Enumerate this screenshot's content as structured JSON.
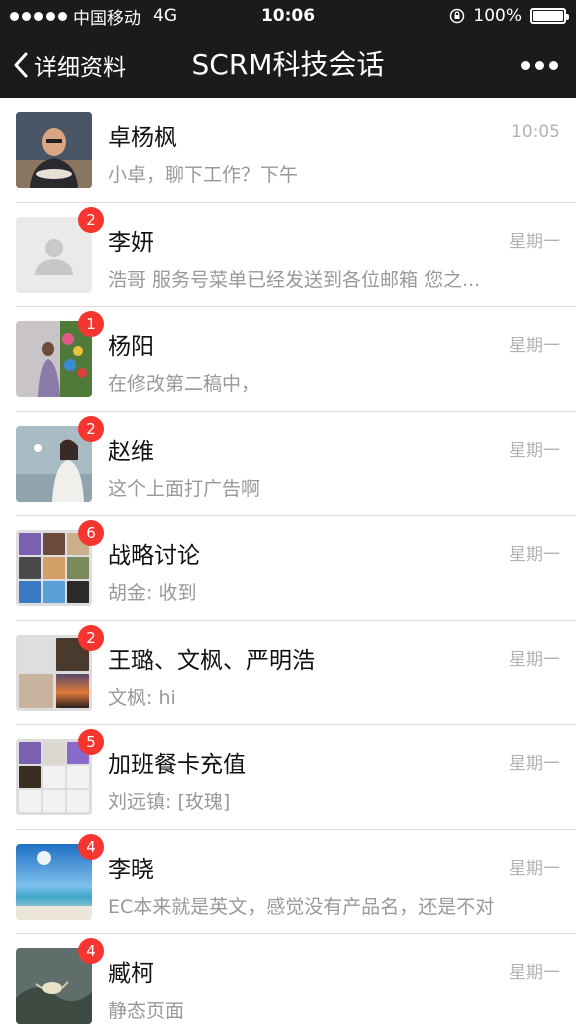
{
  "status_bar": {
    "carrier": "中国移动",
    "network": "4G",
    "time": "10:06",
    "battery": "100%",
    "battery_level": 1.0
  },
  "nav": {
    "back_label": "详细资料",
    "title": "SCRM科技会话"
  },
  "chats": [
    {
      "name": "卓杨枫",
      "time": "10:05",
      "preview": "小卓，聊下工作？下午",
      "badge": ""
    },
    {
      "name": "李妍",
      "time": "星期一",
      "preview": "浩哥  服务号菜单已经发送到各位邮箱    您之...",
      "badge": "2"
    },
    {
      "name": "杨阳",
      "time": "星期一",
      "preview": "在修改第二稿中，",
      "badge": "1"
    },
    {
      "name": "赵维",
      "time": "星期一",
      "preview": "这个上面打广告啊",
      "badge": "2"
    },
    {
      "name": "战略讨论",
      "time": "星期一",
      "preview": "胡金: 收到",
      "badge": "6"
    },
    {
      "name": "王璐、文枫、严明浩",
      "time": "星期一",
      "preview": "文枫: hi",
      "badge": "2"
    },
    {
      "name": "加班餐卡充值",
      "time": "星期一",
      "preview": "刘远镇: [玫瑰]",
      "badge": "5"
    },
    {
      "name": "李晓",
      "time": "星期一",
      "preview": "EC本来就是英文，感觉没有产品名，还是不对",
      "badge": "4"
    },
    {
      "name": "臧柯",
      "time": "星期一",
      "preview": "静态页面",
      "badge": "4"
    }
  ],
  "colors": {
    "bar_bg": "#1b1b1d",
    "badge": "#f43530",
    "secondary_text": "#999999",
    "time_text": "#b2b2b2"
  }
}
